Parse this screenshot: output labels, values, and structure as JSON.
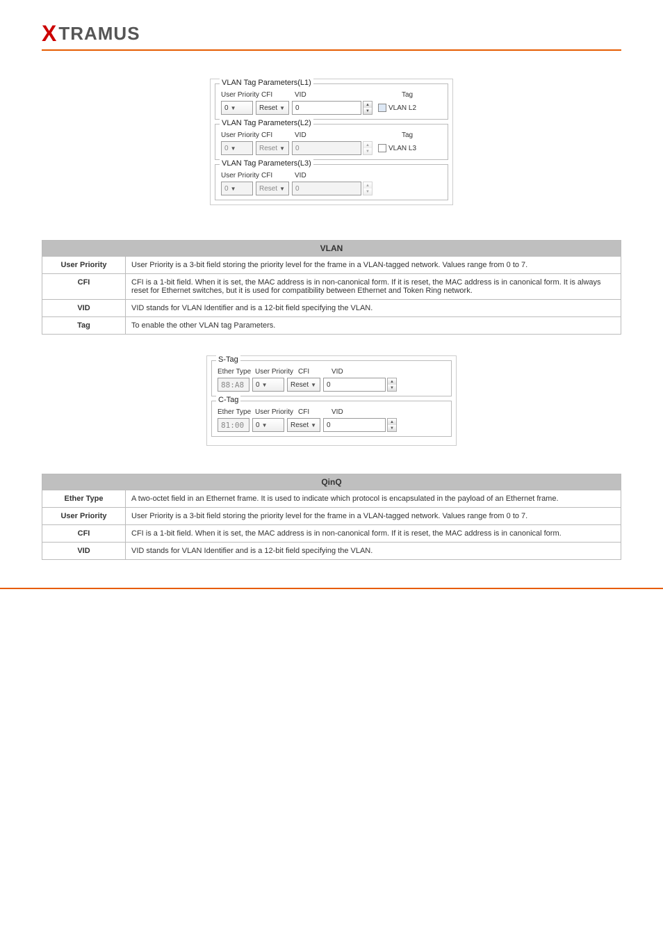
{
  "logo": {
    "x": "X",
    "rest": "TRAMUS"
  },
  "vlan_panels": [
    {
      "legend": "VLAN Tag Parameters(L1)",
      "enabled": true,
      "labels": {
        "up": "User Priority",
        "cfi": "CFI",
        "vid": "VID",
        "tag": "Tag"
      },
      "up": "0",
      "cfi": "Reset",
      "vid": "0",
      "tag_label": "VLAN L2",
      "tag_checked": false,
      "show_tag": true
    },
    {
      "legend": "VLAN Tag Parameters(L2)",
      "enabled": false,
      "labels": {
        "up": "User Priority",
        "cfi": "CFI",
        "vid": "VID",
        "tag": "Tag"
      },
      "up": "0",
      "cfi": "Reset",
      "vid": "0",
      "tag_label": "VLAN L3",
      "tag_checked": false,
      "show_tag": true
    },
    {
      "legend": "VLAN Tag Parameters(L3)",
      "enabled": false,
      "labels": {
        "up": "User Priority",
        "cfi": "CFI",
        "vid": "VID",
        "tag": ""
      },
      "up": "0",
      "cfi": "Reset",
      "vid": "0",
      "tag_label": "",
      "tag_checked": false,
      "show_tag": false
    }
  ],
  "vlan_table": {
    "header": "VLAN",
    "rows": [
      {
        "label": "User Priority",
        "desc": "User Priority is a 3-bit field storing the priority level for the frame in a VLAN-tagged network. Values range from 0 to 7."
      },
      {
        "label": "CFI",
        "desc": "CFI is a 1-bit field. When it is set, the MAC address is in non-canonical form. If it is reset, the MAC address is in canonical form. It is always reset for Ethernet switches, but it is used for compatibility between Ethernet and Token Ring network."
      },
      {
        "label": "VID",
        "desc": "VID stands for VLAN Identifier and is a 12-bit field specifying the VLAN."
      },
      {
        "label": "Tag",
        "desc": "To enable the other VLAN tag Parameters."
      }
    ]
  },
  "qinq_panels": [
    {
      "legend": "S-Tag",
      "labels": {
        "eth": "Ether Type",
        "up": "User Priority",
        "cfi": "CFI",
        "vid": "VID"
      },
      "eth": "88:A8",
      "up": "0",
      "cfi": "Reset",
      "vid": "0"
    },
    {
      "legend": "C-Tag",
      "labels": {
        "eth": "Ether Type",
        "up": "User Priority",
        "cfi": "CFI",
        "vid": "VID"
      },
      "eth": "81:00",
      "up": "0",
      "cfi": "Reset",
      "vid": "0"
    }
  ],
  "qinq_table": {
    "header": "QinQ",
    "rows": [
      {
        "label": "Ether Type",
        "desc": "A two-octet field in an Ethernet frame. It is used to indicate which protocol is encapsulated in the payload of an Ethernet frame."
      },
      {
        "label": "User Priority",
        "desc": "User Priority is a 3-bit field storing the priority level for the frame in a VLAN-tagged network. Values range from 0 to 7."
      },
      {
        "label": "CFI",
        "desc": "CFI is a 1-bit field. When it is set, the MAC address is in non-canonical form. If it is reset, the MAC address is in canonical form."
      },
      {
        "label": "VID",
        "desc": "VID stands for VLAN Identifier and is a 12-bit field specifying the VLAN."
      }
    ]
  },
  "footer": {
    "left": "",
    "right": ""
  }
}
